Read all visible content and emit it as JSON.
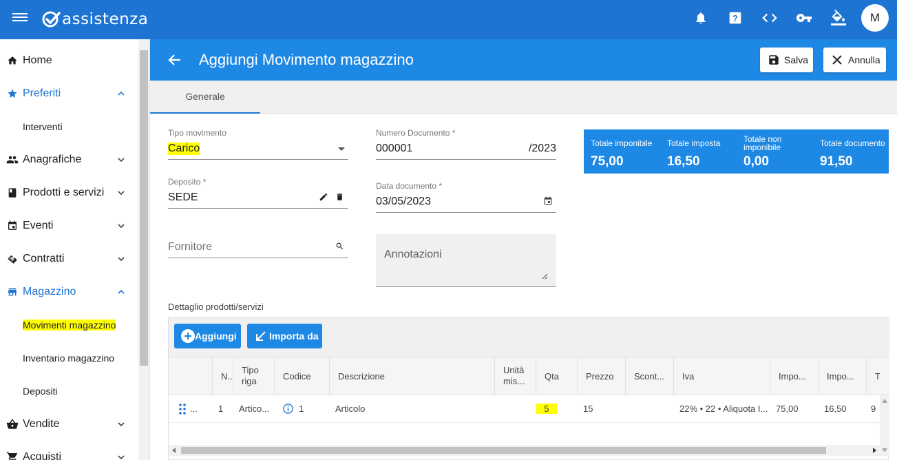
{
  "topbar": {
    "app_name": "assistenza",
    "avatar_letter": "M",
    "icons": [
      "bell-icon",
      "help-icon",
      "code-icon",
      "key-icon",
      "paint-bucket-icon"
    ]
  },
  "sidebar": {
    "items": [
      {
        "label": "Home",
        "icon": "home-icon"
      },
      {
        "label": "Preferiti",
        "icon": "star-icon",
        "expanded": true
      },
      {
        "label": "Interventi"
      },
      {
        "label": "Anagrafiche",
        "icon": "people-icon"
      },
      {
        "label": "Prodotti e servizi",
        "icon": "book-icon"
      },
      {
        "label": "Eventi",
        "icon": "calendar-icon"
      },
      {
        "label": "Contratti",
        "icon": "handshake-icon"
      },
      {
        "label": "Magazzino",
        "icon": "store-icon",
        "expanded": true
      },
      {
        "label": "Movimenti magazzino",
        "highlighted": true
      },
      {
        "label": "Inventario magazzino"
      },
      {
        "label": "Depositi"
      },
      {
        "label": "Vendite",
        "icon": "basket-icon"
      },
      {
        "label": "Acquisti",
        "icon": "cart-icon"
      }
    ]
  },
  "header": {
    "title": "Aggiungi Movimento magazzino",
    "save_label": "Salva",
    "cancel_label": "Annulla"
  },
  "tabs": [
    {
      "label": "Generale"
    }
  ],
  "form": {
    "tipo_movimento": {
      "label": "Tipo movimento",
      "value": "Carico"
    },
    "numero_documento": {
      "label": "Numero Documento *",
      "value": "000001",
      "suffix": "/2023"
    },
    "deposito": {
      "label": "Deposito *",
      "value": "SEDE"
    },
    "data_documento": {
      "label": "Data documento *",
      "value": "03/05/2023"
    },
    "fornitore": {
      "placeholder": "Fornitore"
    },
    "annotazioni": {
      "placeholder": "Annotazioni"
    }
  },
  "totals": [
    {
      "label": "Totale imponibile",
      "value": "75,00"
    },
    {
      "label": "Totale imposta",
      "value": "16,50"
    },
    {
      "label": "Totale non imponibile",
      "value": "0,00"
    },
    {
      "label": "Totale documento",
      "value": "91,50"
    }
  ],
  "details": {
    "section_label": "Dettaglio prodotti/servizi",
    "add_label": "Aggiungi",
    "import_label": "Importa da",
    "columns": [
      "N...",
      "Tipo riga",
      "Codice",
      "Descrizione",
      "Unità mis...",
      "Qta",
      "Prezzo",
      "Scont...",
      "Iva",
      "Impo...",
      "Impo...",
      "T"
    ],
    "rows": [
      {
        "drag": "...",
        "n": "1",
        "tipo": "Artico...",
        "codice": "1",
        "descrizione": "Articolo",
        "unita": "",
        "qta": "5",
        "prezzo": "15",
        "sconto": "",
        "iva": "22% • 22 • Aliquota I...",
        "imponibile": "75,00",
        "imposta": "16,50",
        "totale": "9"
      }
    ]
  },
  "colors": {
    "primary": "#1e74d3",
    "header_blue": "#1e88e5",
    "highlight": "#ffff00"
  }
}
